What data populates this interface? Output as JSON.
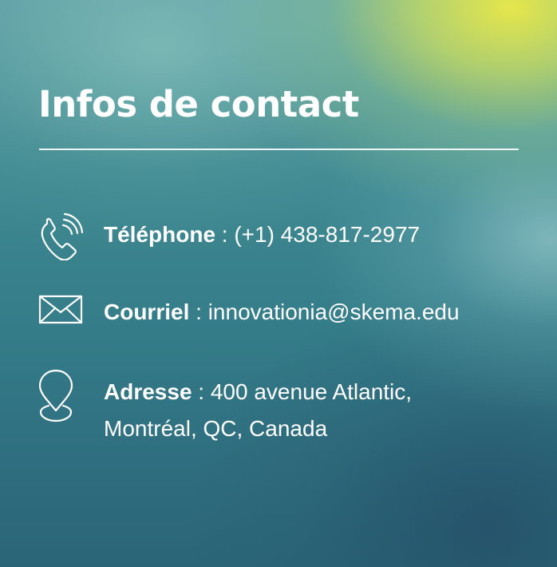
{
  "title": "Infos de contact",
  "contacts": {
    "phone": {
      "icon": "phone-icon",
      "label": "Téléphone",
      "separator": " : ",
      "value": "(+1) 438-817-2977"
    },
    "email": {
      "icon": "envelope-icon",
      "label": "Courriel",
      "separator": " : ",
      "value": "innovationia@skema.edu"
    },
    "address": {
      "icon": "map-pin-icon",
      "label": "Adresse",
      "separator": " : ",
      "value_line1": "400 avenue Atlantic,",
      "value_line2": "Montréal, QC, Canada"
    }
  },
  "colors": {
    "text": "#ffffff",
    "accent_yellow": "#eceA46",
    "teal": "#357e8a",
    "deep_teal": "#2a6577"
  }
}
